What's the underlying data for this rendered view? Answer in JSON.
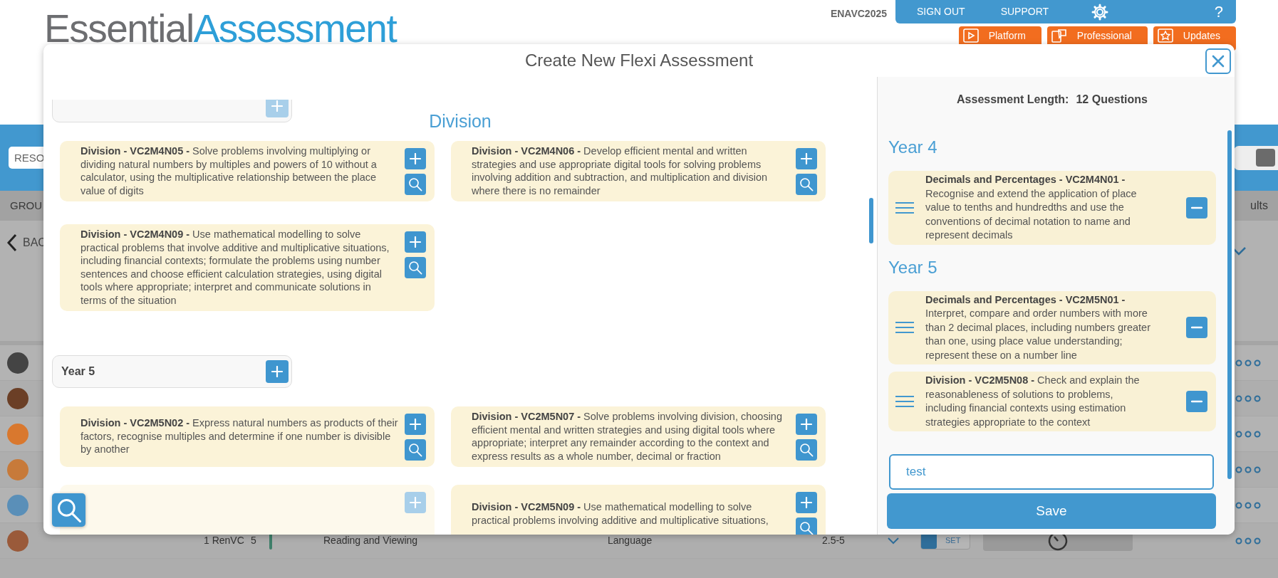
{
  "header": {
    "logo": [
      "Essential",
      "Assessment"
    ],
    "account": "ENAVC2025",
    "nav": [
      "SIGN OUT",
      "SUPPORT"
    ],
    "help": "?",
    "quick_links": [
      {
        "kind": "video",
        "label": "Platform"
      },
      {
        "kind": "portal",
        "label": "Professional"
      },
      {
        "kind": "star",
        "label": "Updates"
      }
    ]
  },
  "filter": {
    "value": "RESO",
    "switch_on": true
  },
  "group_bar": {
    "left": "GROU",
    "right": "ults"
  },
  "back": "BAC",
  "rows": [
    {
      "kind": "avatar"
    },
    {
      "kind": "avatar"
    },
    {
      "kind": "avatar"
    },
    {
      "kind": "avatar"
    },
    {
      "kind": "avatar"
    },
    {
      "kind": "detail",
      "cells": [
        "1 RenVC",
        "5",
        "Reading and Viewing",
        "Language",
        "2.5-5"
      ],
      "toggle": "SET",
      "toggle_on": true
    }
  ],
  "modal": {
    "title": "Create New Flexi Assessment",
    "sections": [
      {
        "kind": "cut",
        "added": true,
        "heading": "Division",
        "outcomes": [
          {
            "title": "Division - VC2M4N05 -",
            "text": "Solve problems involving multiplying or dividing natural numbers by multiples and powers of 10 without a calculator, using the multiplicative relationship between the place value of digits",
            "added": false
          },
          {
            "title": "Division - VC2M4N06 -",
            "text": "Develop efficient mental and written strategies and use appropriate digital tools for solving problems involving addition and subtraction, and multiplication and division where there is no remainder",
            "added": false
          },
          {
            "title": "Division - VC2M4N09 -",
            "text": "Use mathematical modelling to solve practical problems that involve additive and multiplicative situations, including financial contexts; formulate the problems using number sentences and choose efficient calculation strategies, using digital tools where appropriate; interpret and communicate solutions in terms of the situation",
            "added": false
          }
        ]
      },
      {
        "kind": "year",
        "label": "Year 5",
        "added": false,
        "outcomes": [
          {
            "title": "Division - VC2M5N02 -",
            "text": "Express natural numbers as products of their factors, recognise multiples and determine if one number is divisible by another",
            "added": false
          },
          {
            "title": "Division - VC2M5N07 -",
            "text": "Solve problems involving division, choosing efficient mental and written strategies and using digital tools where appropriate; interpret any remainder according to the context and express results as a whole number, decimal or fraction",
            "added": false
          },
          {
            "added": true
          },
          {
            "title": "Division - VC2M5N09 -",
            "text": "Use mathematical modelling to solve practical problems involving additive and multiplicative situations,",
            "added": false
          }
        ]
      }
    ],
    "summary": {
      "label": "Assessment Length:",
      "value": "12 Questions",
      "years": [
        {
          "label": "Year 4",
          "items": [
            {
              "title": "Decimals and Percentages - VC2M4N01 -",
              "text": "Recognise and extend the application of place value to tenths and hundredths and use the conventions of decimal notation to name and represent decimals"
            }
          ]
        },
        {
          "label": "Year 5",
          "items": [
            {
              "title": "Decimals and Percentages - VC2M5N01 -",
              "text": "Interpret, compare and order numbers with more than 2 decimal places, including numbers greater than one, using place value understanding; represent these on a number line"
            },
            {
              "title": "Division - VC2M5N08 -",
              "text": "Check and explain the reasonableness of solutions to problems, including financial contexts using estimation strategies appropriate to the context"
            }
          ]
        }
      ],
      "name": "test",
      "save": "Save"
    }
  }
}
